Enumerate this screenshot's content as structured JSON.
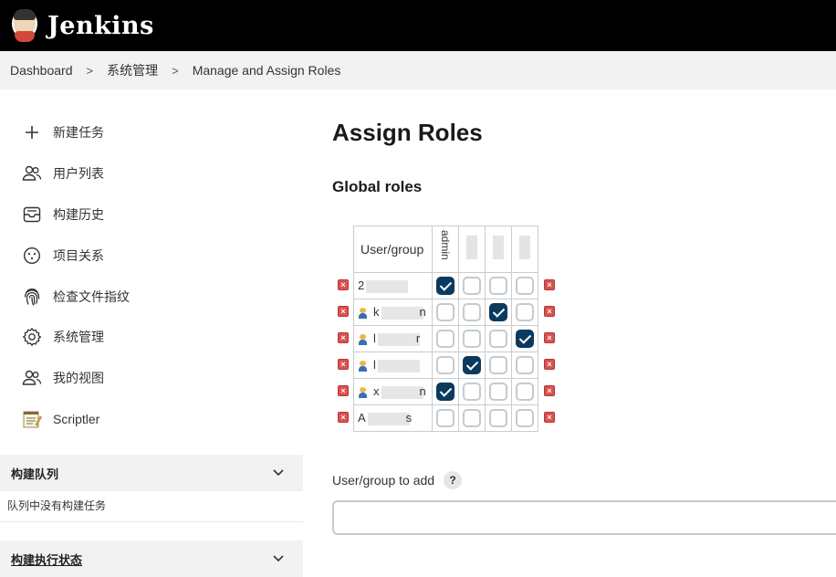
{
  "header": {
    "brand": "Jenkins"
  },
  "breadcrumb": {
    "items": [
      "Dashboard",
      "系统管理",
      "Manage and Assign Roles"
    ],
    "separator": ">"
  },
  "sidebar": {
    "items": [
      {
        "icon": "plus-icon",
        "label": "新建任务"
      },
      {
        "icon": "users-icon",
        "label": "用户列表"
      },
      {
        "icon": "inbox-icon",
        "label": "构建历史"
      },
      {
        "icon": "project-relations-icon",
        "label": "项目关系"
      },
      {
        "icon": "fingerprint-icon",
        "label": "检查文件指纹"
      },
      {
        "icon": "gear-icon",
        "label": "系统管理"
      },
      {
        "icon": "users-icon",
        "label": "我的视图"
      },
      {
        "icon": "notepad-icon",
        "label": "Scriptler"
      }
    ],
    "build_queue": {
      "title": "构建队列",
      "empty": "队列中没有构建任务"
    },
    "executor_status": {
      "title": "构建执行状态"
    }
  },
  "main": {
    "title": "Assign Roles",
    "section": "Global roles",
    "table": {
      "corner": "User/group",
      "roles": [
        "admin",
        "",
        "",
        ""
      ],
      "rows": [
        {
          "name": "2",
          "user_icon": false,
          "checks": [
            true,
            false,
            false,
            false
          ]
        },
        {
          "name": "k",
          "suffix": "n",
          "user_icon": true,
          "checks": [
            false,
            false,
            true,
            false
          ]
        },
        {
          "name": "l",
          "suffix": "r",
          "user_icon": true,
          "checks": [
            false,
            false,
            false,
            true
          ]
        },
        {
          "name": "l",
          "suffix": "",
          "user_icon": true,
          "checks": [
            false,
            true,
            false,
            false
          ]
        },
        {
          "name": "x",
          "suffix": "n",
          "user_icon": true,
          "checks": [
            true,
            false,
            false,
            false
          ]
        },
        {
          "name": "A",
          "suffix": "s",
          "user_icon": false,
          "checks": [
            false,
            false,
            false,
            false
          ]
        }
      ]
    },
    "add": {
      "label": "User/group to add",
      "help": "?",
      "value": ""
    },
    "colors": {
      "checked": "#0b3a5e",
      "delete": "#d9534f"
    }
  }
}
